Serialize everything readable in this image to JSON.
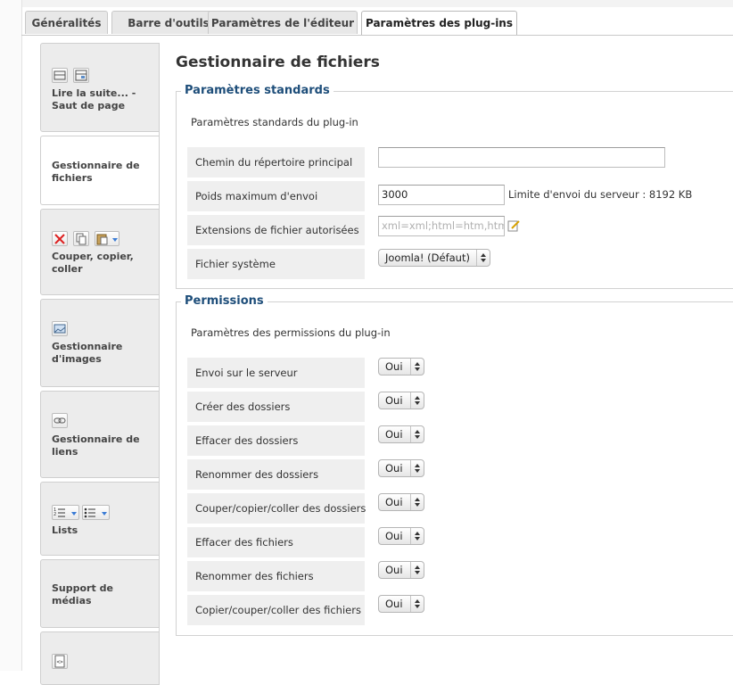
{
  "tabs": [
    {
      "label": "Généralités"
    },
    {
      "label": "Barre d'outils"
    },
    {
      "label": "Paramètres de l'éditeur"
    },
    {
      "label": "Paramètres des plug-ins"
    }
  ],
  "sidebar": {
    "items": [
      {
        "label": "Lire la suite... - Saut de page",
        "icons": [
          "readmore-icon",
          "pagebreak-icon"
        ]
      },
      {
        "label": "Gestionnaire de fichiers",
        "icons": []
      },
      {
        "label": "Couper, copier, coller",
        "icons": [
          "cut-icon",
          "copy-icon",
          "paste-icon"
        ]
      },
      {
        "label": "Gestionnaire d'images",
        "icons": [
          "image-icon"
        ]
      },
      {
        "label": "Gestionnaire de liens",
        "icons": [
          "link-icon"
        ]
      },
      {
        "label": "Lists",
        "icons": [
          "ordered-list-icon",
          "unordered-list-icon"
        ]
      },
      {
        "label": "Support de médias",
        "icons": []
      },
      {
        "label": "",
        "icons": [
          "source-code-icon"
        ]
      }
    ]
  },
  "main": {
    "title": "Gestionnaire de fichiers",
    "standard": {
      "legend": "Paramètres standards",
      "description": "Paramètres standards du plug-in",
      "rows": [
        {
          "label": "Chemin du répertoire principal",
          "value": ""
        },
        {
          "label": "Poids maximum d'envoi",
          "value": "3000",
          "hint": "Limite d'envoi du serveur : 8192 KB"
        },
        {
          "label": "Extensions de fichier autorisées",
          "placeholder": "xml=xml;html=htm,htm"
        },
        {
          "label": "Fichier système",
          "select": "Joomla! (Défaut)"
        }
      ]
    },
    "permissions": {
      "legend": "Permissions",
      "description": "Paramètres des permissions du plug-in",
      "rows": [
        {
          "label": "Envoi sur le serveur",
          "value": "Oui"
        },
        {
          "label": "Créer des dossiers",
          "value": "Oui"
        },
        {
          "label": "Effacer des dossiers",
          "value": "Oui"
        },
        {
          "label": "Renommer des dossiers",
          "value": "Oui"
        },
        {
          "label": "Couper/copier/coller des dossiers",
          "value": "Oui"
        },
        {
          "label": "Effacer des fichiers",
          "value": "Oui"
        },
        {
          "label": "Renommer des fichiers",
          "value": "Oui"
        },
        {
          "label": "Copier/couper/coller des fichiers",
          "value": "Oui"
        }
      ]
    }
  },
  "colors": {
    "legend": "#1e4e7a",
    "row_bg": "#efefef",
    "caret": "#3a7bd5"
  }
}
